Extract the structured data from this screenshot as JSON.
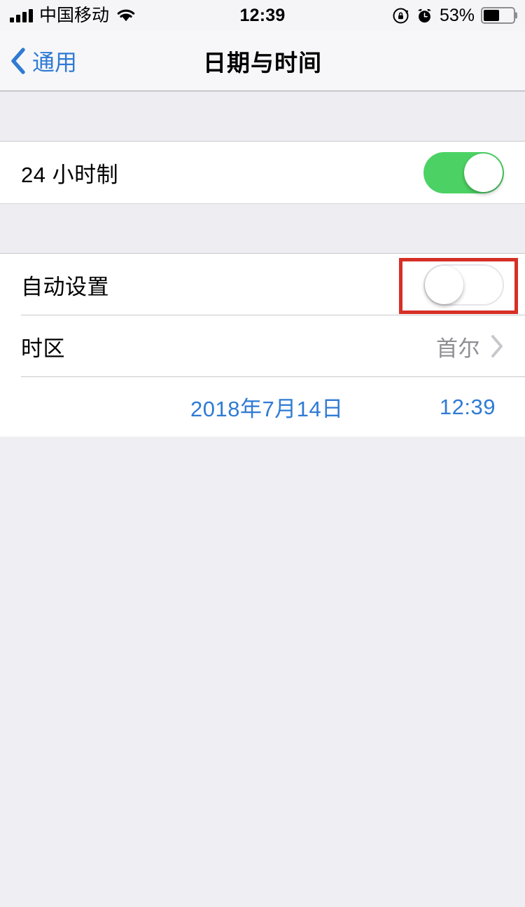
{
  "status_bar": {
    "carrier": "中国移动",
    "signal_bars_total": 4,
    "signal_bars_filled": 4,
    "wifi_icon": "wifi-icon",
    "time": "12:39",
    "rotation_lock_icon": "rotation-lock-icon",
    "alarm_icon": "alarm-clock-icon",
    "battery_percent_label": "53%",
    "battery_level": 53
  },
  "nav_bar": {
    "back_icon": "chevron-left-icon",
    "back_label": "通用",
    "title": "日期与时间"
  },
  "sections": [
    {
      "rows": [
        {
          "label": "24 小时制",
          "control": "toggle",
          "toggle_state": "on"
        }
      ]
    },
    {
      "rows": [
        {
          "label": "自动设置",
          "control": "toggle",
          "toggle_state": "off"
        },
        {
          "label": "时区",
          "control": "disclosure",
          "value": "首尔",
          "chevron_icon": "chevron-right-icon"
        }
      ],
      "datetime": {
        "date": "2018年7月14日",
        "time": "12:39"
      }
    }
  ],
  "annotation": {
    "type": "highlight-rectangle",
    "color": "#d62f26",
    "target": "自动设置 toggle"
  },
  "colors": {
    "accent_blue": "#2f7bd4",
    "toggle_on_green": "#4cd264",
    "value_gray": "#8e8e93",
    "page_background": "#efeef3",
    "row_background": "#ffffff",
    "annotation_red": "#d62f26"
  }
}
